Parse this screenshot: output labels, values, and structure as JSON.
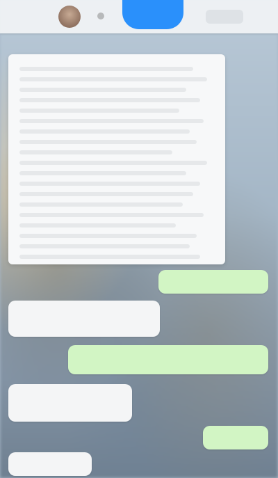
{
  "header": {
    "avatar_icon": "contact-avatar-icon",
    "status_icon": "status-dot-icon",
    "call_icon": "call-button-icon",
    "menu_icon": "menu-icon",
    "accent_color": "#1f8cff"
  },
  "conversation": {
    "document_icon": "document-preview-icon",
    "messages": [
      {
        "direction": "outgoing",
        "text": ""
      },
      {
        "direction": "incoming",
        "text": ""
      },
      {
        "direction": "outgoing",
        "text": ""
      },
      {
        "direction": "incoming",
        "text": ""
      },
      {
        "direction": "outgoing",
        "text": ""
      },
      {
        "direction": "incoming",
        "text": ""
      }
    ],
    "incoming_color": "#f4f5f6",
    "outgoing_color": "#d2f5c4"
  }
}
